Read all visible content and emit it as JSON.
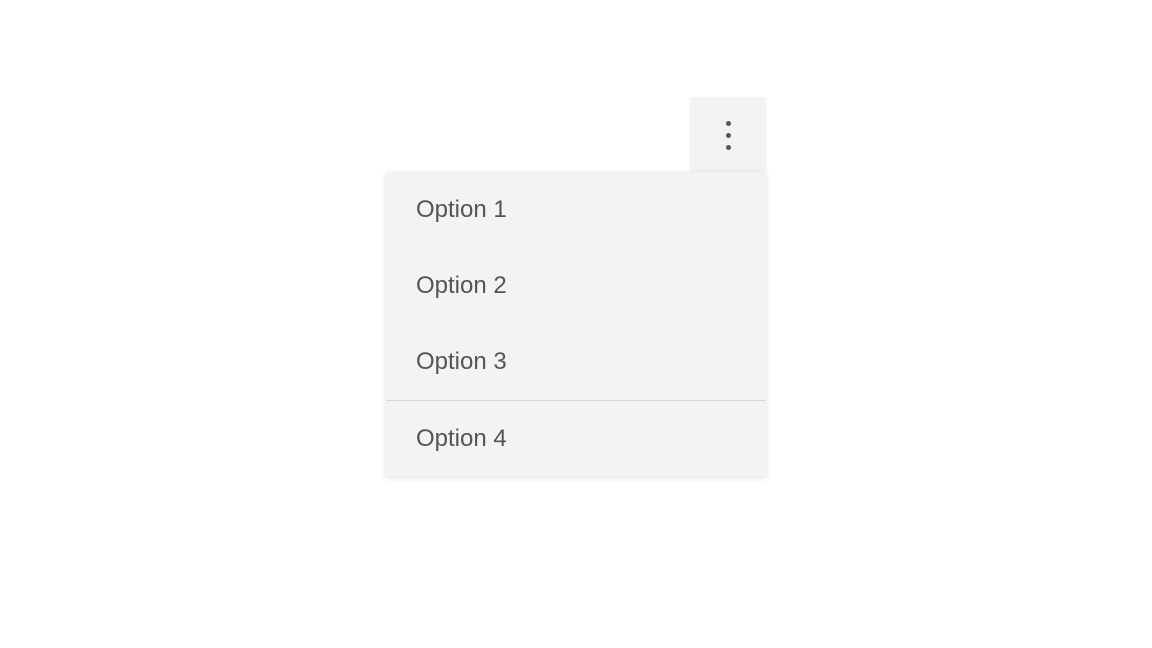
{
  "menu": {
    "trigger_icon": "more-vertical",
    "items": [
      {
        "label": "Option 1"
      },
      {
        "label": "Option 2"
      },
      {
        "label": "Option 3"
      },
      {
        "label": "Option 4"
      }
    ]
  }
}
